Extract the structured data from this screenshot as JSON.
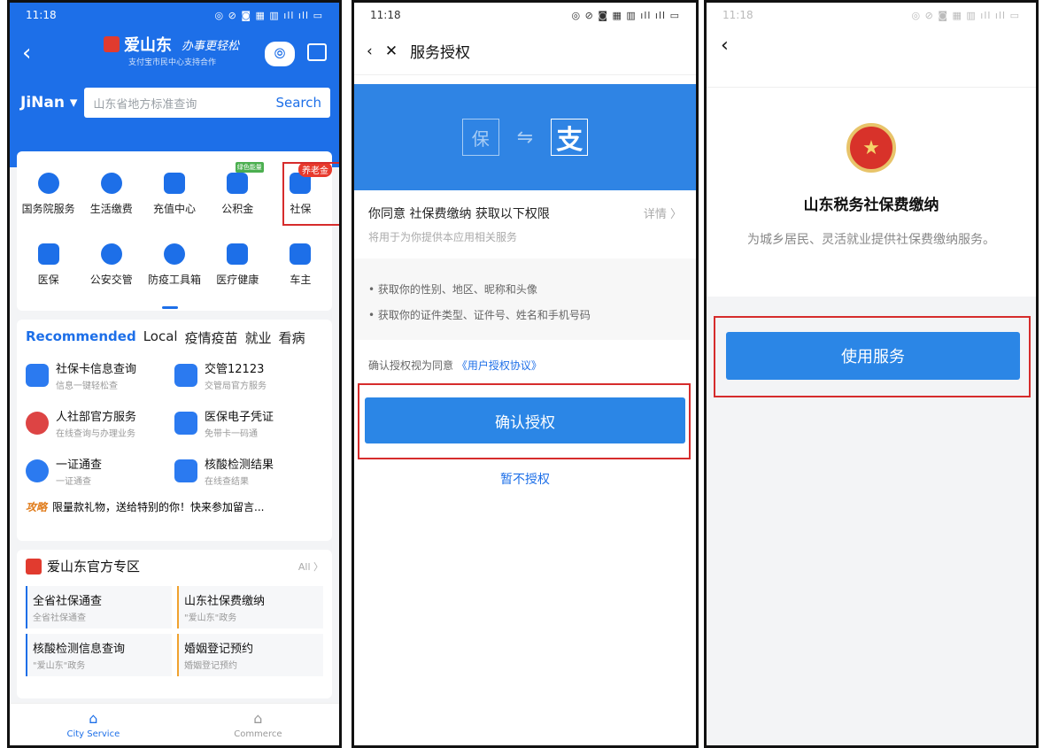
{
  "phone1": {
    "time": "11:18",
    "status_icons": "◎ ⊘ ◙ ▦ ▥ ıll ıll ▭",
    "logo_title": "爱山东",
    "logo_slogan": "办事更轻松",
    "logo_sub": "支付宝市民中心支持合作",
    "city": "JiNan",
    "search_placeholder": "山东省地方标准查询",
    "search_button": "Search",
    "grid": [
      {
        "label": "国务院服务",
        "icon": "smiley-icon"
      },
      {
        "label": "生活缴费",
        "icon": "bolt-icon"
      },
      {
        "label": "充值中心",
        "icon": "phone-icon"
      },
      {
        "label": "公积金",
        "icon": "house-icon",
        "badge": "绿色能量"
      },
      {
        "label": "社保",
        "icon": "hands-icon",
        "badge": "养老金"
      },
      {
        "label": "医保",
        "icon": "medical-card-icon"
      },
      {
        "label": "公安交管",
        "icon": "police-cap-icon"
      },
      {
        "label": "防疫工具箱",
        "icon": "clock-icon"
      },
      {
        "label": "医疗健康",
        "icon": "capsule-icon"
      },
      {
        "label": "车主",
        "icon": "car-icon"
      }
    ],
    "tabs": [
      "Recommended",
      "Local",
      "疫情疫苗",
      "就业",
      "看病"
    ],
    "services": [
      {
        "title": "社保卡信息查询",
        "sub": "信息一键轻松查"
      },
      {
        "title": "交管12123",
        "sub": "交管局官方服务"
      },
      {
        "title": "人社部官方服务",
        "sub": "在线查询与办理业务"
      },
      {
        "title": "医保电子凭证",
        "sub": "免带卡一码通"
      },
      {
        "title": "一证通查",
        "sub": "一证通查"
      },
      {
        "title": "核酸检测结果",
        "sub": "在线查结果"
      }
    ],
    "promo_tag": "攻略",
    "promo_text": "限量款礼物，送给特别的你！快来参加留言...",
    "official_title": "爱山东官方专区",
    "official_all": "All",
    "official": [
      {
        "title": "全省社保通查",
        "sub": "全省社保通查"
      },
      {
        "title": "山东社保费缴纳",
        "sub": "\"爱山东\"政务"
      },
      {
        "title": "核酸检测信息查询",
        "sub": "\"爱山东\"政务"
      },
      {
        "title": "婚姻登记预约",
        "sub": "婚姻登记预约"
      }
    ],
    "nav": [
      {
        "label": "City Service",
        "icon": "⌂"
      },
      {
        "label": "Commerce",
        "icon": "⌂"
      }
    ]
  },
  "phone2": {
    "time": "11:18",
    "status_icons": "◎ ⊘ ◙ ▦ ▥ ıll ıll ▭",
    "title": "服务授权",
    "banner_left": "保",
    "banner_right": "支",
    "agree_line": "你同意 社保费缴纳 获取以下权限",
    "detail": "详情 〉",
    "usage": "将用于为你提供本应用相关服务",
    "perm1": "• 获取你的性别、地区、昵称和头像",
    "perm2": "• 获取你的证件类型、证件号、姓名和手机号码",
    "consent_text": "确认授权视为同意",
    "consent_link": "《用户授权协议》",
    "confirm": "确认授权",
    "deny": "暂不授权"
  },
  "phone3": {
    "time": "11:18",
    "status_icons": "◎ ⊘ ◙ ▦ ▥ ıll ıll ▭",
    "title": "山东税务社保费缴纳",
    "desc": "为城乡居民、灵活就业提供社保费缴纳服务。",
    "button": "使用服务"
  }
}
